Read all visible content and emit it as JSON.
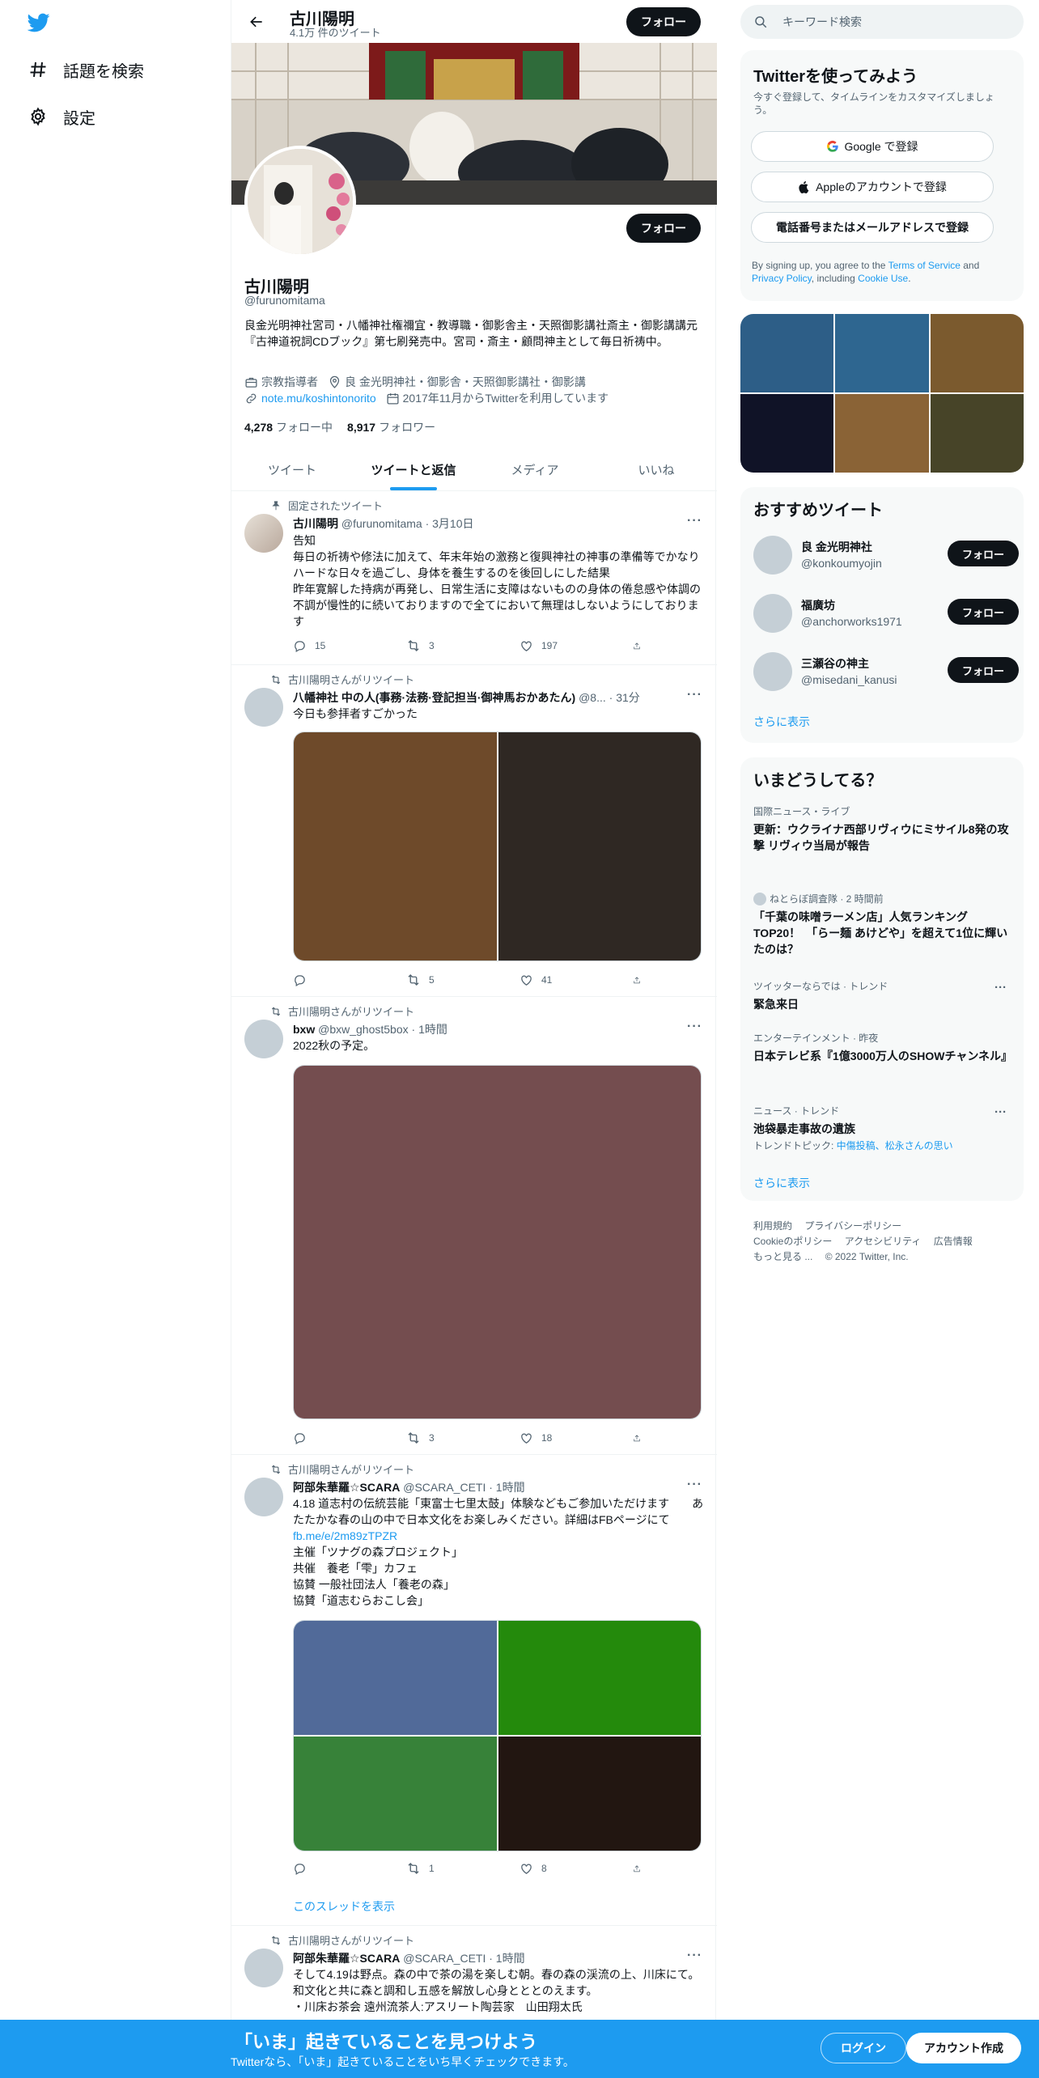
{
  "nav": {
    "explore_label": "話題を検索",
    "settings_label": "設定"
  },
  "header": {
    "name": "古川陽明",
    "tweet_count": "4.1万 件のツイート",
    "follow_label": "フォロー"
  },
  "profile": {
    "name": "古川陽明",
    "handle": "@furunomitama",
    "follow_label": "フォロー",
    "bio": "良金光明神社宮司・八幡神社権禰宜・教導職・御影舎主・天照御影講社斎主・御影講講元『古神道祝詞CDブック』第七刷発売中。宮司・斎主・顧問神主として毎日祈祷中。",
    "category": "宗教指導者",
    "location": "良 金光明神社・御影舎・天照御影講社・御影講",
    "website": "note.mu/koshintonorito",
    "joined": "2017年11月からTwitterを利用しています",
    "following_count": "4,278",
    "following_label": "フォロー中",
    "followers_count": "8,917",
    "followers_label": "フォロワー"
  },
  "tabs": [
    "ツイート",
    "ツイートと返信",
    "メディア",
    "いいね"
  ],
  "tweets": [
    {
      "context": "固定されたツイート",
      "name": "古川陽明",
      "handle": "@furunomitama · 3月10日",
      "text": "告知\n毎日の祈祷や修法に加えて、年末年始の激務と復興神社の神事の準備等でかなりハードな日々を過ごし、身体を養生するのを後回しにした結果\n昨年寛解した持病が再発し、日常生活に支障はないものの身体の倦怠感や体調の不調が慢性的に続いておりますので全てにおいて無理はしないようにしております",
      "reply": "15",
      "retweet": "3",
      "like": "197"
    },
    {
      "context": "古川陽明さんがリツイート",
      "name": "八幡神社 中の人(事務·法務·登記担当·御神馬おかあたん)",
      "handle": "@8... · 31分",
      "text": "今日も参拝者すごかった",
      "reply": "",
      "retweet": "5",
      "like": "41"
    },
    {
      "context": "古川陽明さんがリツイート",
      "name": "bxw",
      "handle": "@bxw_ghost5box · 1時間",
      "text": "2022秋の予定。",
      "reply": "",
      "retweet": "3",
      "like": "18"
    },
    {
      "context": "古川陽明さんがリツイート",
      "name": "阿部朱華羅☆SCARA",
      "handle": "@SCARA_CETI · 1時間",
      "text": "4.18 道志村の伝統芸能「東富士七里太鼓」体験などもご参加いただけます　　あたたかな春の山の中で日本文化をお楽しみください。詳細はFBページにて",
      "link": "fb.me/e/2m89zTPZR",
      "text2": "主催「ツナグの森プロジェクト」\n共催　養老「雫」カフェ\n協賛 一般社団法人「養老の森」\n協賛「道志むらおこし会」",
      "reply": "",
      "retweet": "1",
      "like": "8",
      "thread_label": "このスレッドを表示"
    },
    {
      "context": "古川陽明さんがリツイート",
      "name": "阿部朱華羅☆SCARA",
      "handle": "@SCARA_CETI · 1時間",
      "text": "そして4.19は野点。森の中で茶の湯を楽しむ朝。春の森の渓流の上、川床にて。和文化と共に森と調和し五感を解放し心身とととのえます。\n・川床お茶会 遠州流茶人:アスリート陶芸家　山田翔太氏"
    }
  ],
  "right": {
    "search_placeholder": "キーワード検索",
    "signup": {
      "title": "Twitterを使ってみよう",
      "desc": "今すぐ登録して、タイムラインをカスタマイズしましょう。",
      "google": "Google で登録",
      "apple": "Appleのアカウントで登録",
      "phone": "電話番号またはメールアドレスで登録",
      "terms_pre": "By signing up, you agree to the ",
      "terms": "Terms of Service",
      "and": " and ",
      "privacy": "Privacy Policy",
      "including": ", including ",
      "cookie": "Cookie Use",
      "period": "."
    },
    "who_to_follow": {
      "title": "おすすめツイート",
      "items": [
        {
          "name": "良 金光明神社",
          "handle": "@konkoumyojin"
        },
        {
          "name": "福廣坊",
          "handle": "@anchorworks1971"
        },
        {
          "name": "三瀬谷の神主",
          "handle": "@misedani_kanusi"
        }
      ],
      "follow_label": "フォロー",
      "more": "さらに表示"
    },
    "trends": {
      "title": "いまどうしてる？",
      "items": [
        {
          "meta": "国際ニュース・ライブ",
          "title": "更新：ウクライナ西部リヴィウにミサイル8発の攻撃 リヴィウ当局が報告"
        },
        {
          "meta": "ねとらぼ調査隊 · 2 時間前",
          "title": "「千葉の味噌ラーメン店」人気ランキングTOP20！　「らー麺 あけどや」を超えて1位に輝いたのは？"
        },
        {
          "meta": "ツイッターならでは · トレンド",
          "title": "緊急来日"
        },
        {
          "meta": "エンターテインメント · 昨夜",
          "title": "日本テレビ系『1億3000万人のSHOWチャンネル』"
        },
        {
          "meta": "ニュース · トレンド",
          "title": "池袋暴走事故の遺族",
          "sub_pre": "トレンドトピック: ",
          "sub_links": "中傷投稿、松永さんの思い"
        }
      ],
      "more": "さらに表示"
    },
    "footer": [
      "利用規約",
      "プライバシーポリシー",
      "Cookieのポリシー",
      "アクセシビリティ",
      "広告情報",
      "もっと見る ...",
      "© 2022 Twitter, Inc."
    ]
  },
  "bottom_bar": {
    "title": "「いま」起きていることを見つけよう",
    "subtitle": "Twitterなら、「いま」起きていることをいち早くチェックできます。",
    "login": "ログイン",
    "signup": "アカウント作成"
  },
  "colors": {
    "accent": "#1d9bf0",
    "text": "#0f1419",
    "muted": "#536471",
    "bottom_bar": "#1d9bf0"
  }
}
